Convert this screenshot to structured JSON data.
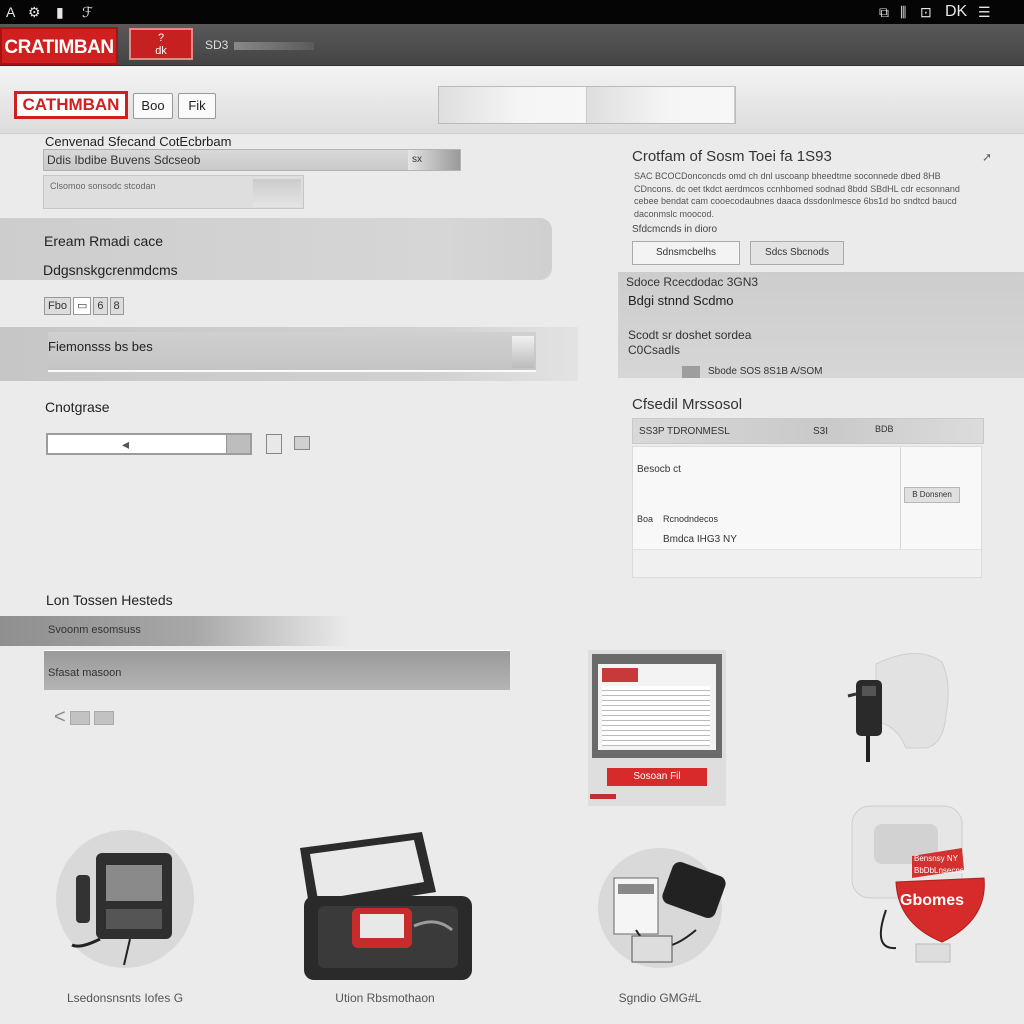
{
  "sysbar": {
    "left_icons": [
      "A",
      "⚙",
      "▮",
      "ℱ"
    ],
    "right_icons": [
      "⧉",
      "⫼",
      "⊡",
      "DK",
      "☰"
    ]
  },
  "header": {
    "logo": "CRATIMBAN",
    "btn_lines": [
      "?",
      "dk"
    ],
    "search_text": "SD3"
  },
  "toolbar": {
    "logo": "CATHMBAN",
    "btn1": "Boo",
    "btn2": "Fik"
  },
  "left": {
    "section_label": "Cenvenad Sfecand CotEcbrbam",
    "select_value": "Ddis Ibdibe Buvens Sdcseob",
    "select_btn": "sx",
    "sub_field_text": "Clsomoo sonsodc stcodan",
    "band1_line1": "Eream Rmadi cace",
    "band1_line2": "Ddgsnskgcrenmdcms",
    "row_chips": [
      "Fbo",
      "▭",
      "6",
      "8"
    ],
    "band2_label": "Fiemonsss bs bes",
    "category_label": "Cnotgrase",
    "category_arrow": "◂",
    "list_title": "Lon Tossen Hesteds",
    "list_item1": "Svoonm esomsuss",
    "list_item2": "Sfasat masoon",
    "pager_prev": "<"
  },
  "right": {
    "title": "Crotfam of Sosm Toei fa 1S93",
    "desc": "SAC BCOCDonconcds omd ch dnl uscoanp bheedtme soconnede dbed 8HB CDncons. dc oet tkdct aerdmcos ccnhbomed sodnad 8bdd SBdHL cdr ecsonnand cebee bendat cam cooecodaubnes daaca dssdonlmesce 6bs1d bo sndtcd baucd daconmslc moocod. ",
    "sub_label": "Sfdcmcnds in dioro",
    "btn1": "Sdnsmcbelhs",
    "btn2": "Sdcs Sbcnods",
    "spec_title": "Sdoce Rcecdodac 3GN3",
    "spec_heading": "Bdgi stnnd Scdmo",
    "spec_line1": "Scodt sr doshet sordea",
    "spec_line2": "C0Csadls",
    "spec_meta": "Sbode SOS 8S1B A/SOM",
    "msg_title": "Cfsedil Mrssosol",
    "table_head_left": "SS3P TDRONMESL",
    "table_head_mid": "S3I",
    "table_head_right": "BDB",
    "table_line1": "Besocb ct",
    "table_line2_a": "Boa",
    "table_line2_b": "Rcnodndecos",
    "table_line3": "Bmdca IHG3 NY",
    "table_btn": "B Donsnen"
  },
  "products": {
    "card_button": "Sosoan Fil",
    "shield_line1": "Bensnsy NY",
    "shield_line2": "BbDbLnsecns",
    "shield_badge": "Gbomes",
    "caption1": "Lsedonsnsnts Iofes G",
    "caption2": "Ution Rbsmothaon",
    "caption3": "Sgndio GMG#L"
  }
}
